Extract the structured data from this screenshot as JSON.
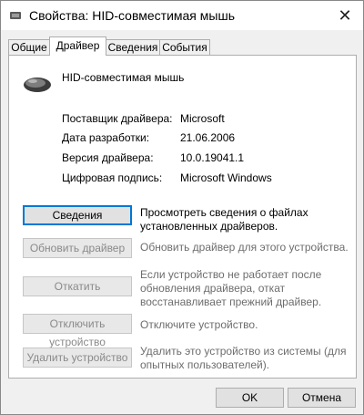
{
  "window": {
    "title": "Свойства: HID-совместимая мышь",
    "close_symbol": "✕"
  },
  "tabs": [
    {
      "label": "Общие",
      "active": false
    },
    {
      "label": "Драйвер",
      "active": true
    },
    {
      "label": "Сведения",
      "active": false
    },
    {
      "label": "События",
      "active": false
    }
  ],
  "device": {
    "name": "HID-совместимая мышь",
    "icon": "mouse-icon"
  },
  "properties": [
    {
      "label": "Поставщик драйвера:",
      "value": "Microsoft"
    },
    {
      "label": "Дата разработки:",
      "value": "21.06.2006"
    },
    {
      "label": "Версия драйвера:",
      "value": "10.0.19041.1"
    },
    {
      "label": "Цифровая подпись:",
      "value": "Microsoft Windows"
    }
  ],
  "actions": [
    {
      "label": "Сведения",
      "description": "Просмотреть сведения о файлах установленных драйверов.",
      "enabled": true
    },
    {
      "label": "Обновить драйвер",
      "description": "Обновить драйвер для этого устройства.",
      "enabled": false
    },
    {
      "label": "Откатить",
      "description": "Если устройство не работает после обновления драйвера, откат восстанавливает прежний драйвер.",
      "enabled": false
    },
    {
      "label": "Отключить устройство",
      "description": "Отключите устройство.",
      "enabled": false
    },
    {
      "label": "Удалить устройство",
      "description": "Удалить это устройство из системы (для опытных пользователей).",
      "enabled": false
    }
  ],
  "footer": {
    "ok_label": "OK",
    "cancel_label": "Отмена"
  }
}
